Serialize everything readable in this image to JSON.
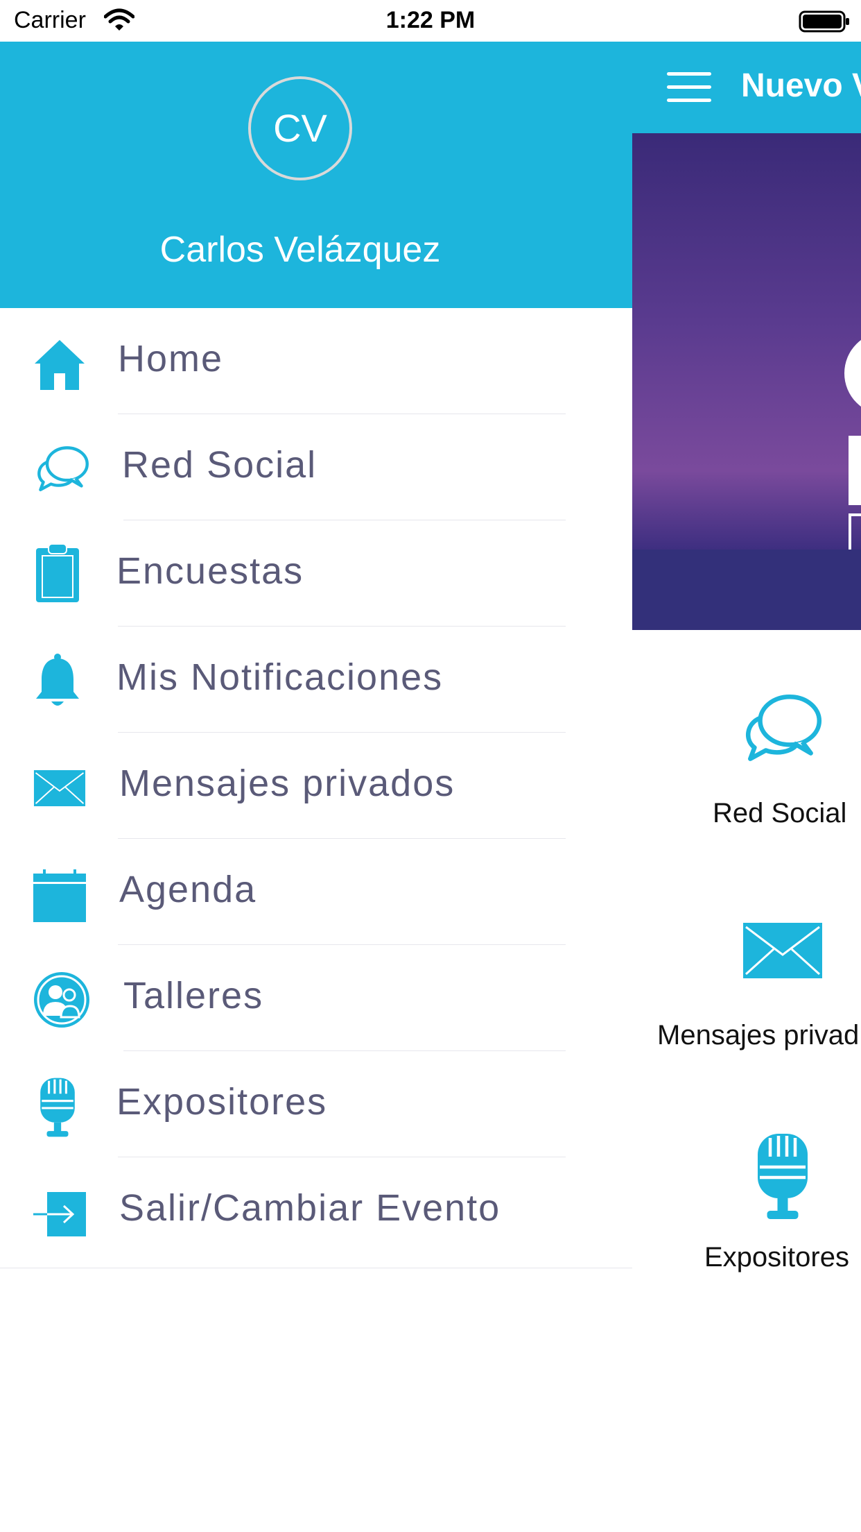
{
  "status_bar": {
    "carrier": "Carrier",
    "time": "1:22 PM"
  },
  "drawer": {
    "avatar_initials": "CV",
    "user_name": "Carlos Velázquez",
    "items": [
      {
        "label": "Home",
        "icon": "home-icon"
      },
      {
        "label": "Red Social",
        "icon": "chat-bubbles-icon"
      },
      {
        "label": "Encuestas",
        "icon": "clipboard-icon"
      },
      {
        "label": "Mis Notificaciones",
        "icon": "bell-icon"
      },
      {
        "label": "Mensajes privados",
        "icon": "envelope-icon"
      },
      {
        "label": "Agenda",
        "icon": "calendar-icon"
      },
      {
        "label": "Talleres",
        "icon": "people-icon"
      },
      {
        "label": "Expositores",
        "icon": "microphone-icon"
      },
      {
        "label": "Salir/Cambiar Evento",
        "icon": "exit-arrow-icon"
      }
    ]
  },
  "main": {
    "nav_title": "Nuevo V",
    "tiles": [
      {
        "label": "Red Social",
        "icon": "chat-bubbles-icon"
      },
      {
        "label": "Mensajes privad",
        "icon": "envelope-icon"
      },
      {
        "label": "Expositores",
        "icon": "microphone-icon"
      }
    ]
  },
  "colors": {
    "accent": "#1db5dc",
    "menu_text": "#5a5a78",
    "banner_purple": "#5a3b8f"
  }
}
